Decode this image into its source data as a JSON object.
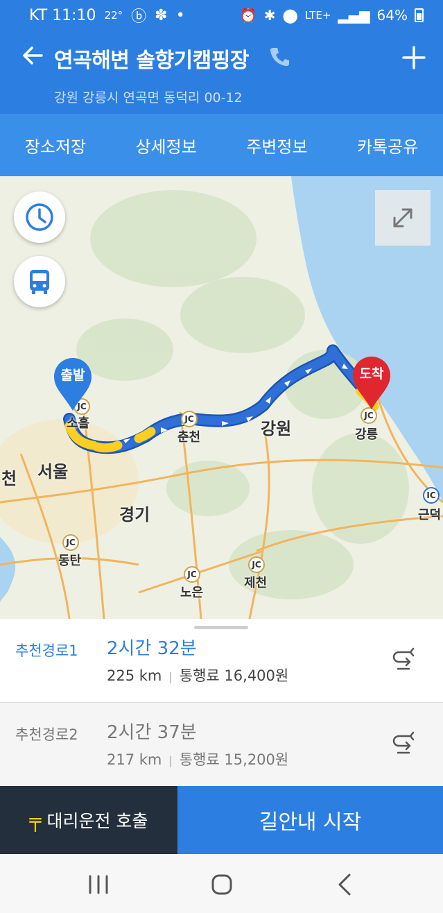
{
  "status": {
    "carrier_time": "KT 11:10",
    "temperature": "22°",
    "network": "LTE+",
    "battery": "64%"
  },
  "header": {
    "title": "연곡해변 솔향기캠핑장",
    "address": "강원 강릉시 연곡면 동덕리 00-12"
  },
  "tabs": [
    {
      "label": "장소저장"
    },
    {
      "label": "상세정보"
    },
    {
      "label": "주변정보"
    },
    {
      "label": "카톡공유"
    }
  ],
  "map": {
    "start_label": "출발",
    "end_label": "도착",
    "places": [
      "소흘",
      "서울",
      "경기",
      "동탄",
      "노은",
      "춘천",
      "강원",
      "강릉",
      "제천",
      "근덕",
      "천"
    ],
    "jc_label": "JC",
    "ic_label": "IC",
    "water_color": "#a9d3f0",
    "land_color": "#eef0e4",
    "route_color": "#2e6fd8",
    "start_pin_color": "#2c7fe0",
    "end_pin_color": "#e0262e"
  },
  "routes": [
    {
      "label": "추천경로1",
      "time": "2시간 32분",
      "distance": "225 km",
      "toll": "통행료 16,400원"
    },
    {
      "label": "추천경로2",
      "time": "2시간 37분",
      "distance": "217 km",
      "toll": "통행료 15,200원"
    }
  ],
  "bottom": {
    "driver_logo": "╤",
    "driver_label": "대리운전 호출",
    "start_label": "길안내 시작"
  }
}
